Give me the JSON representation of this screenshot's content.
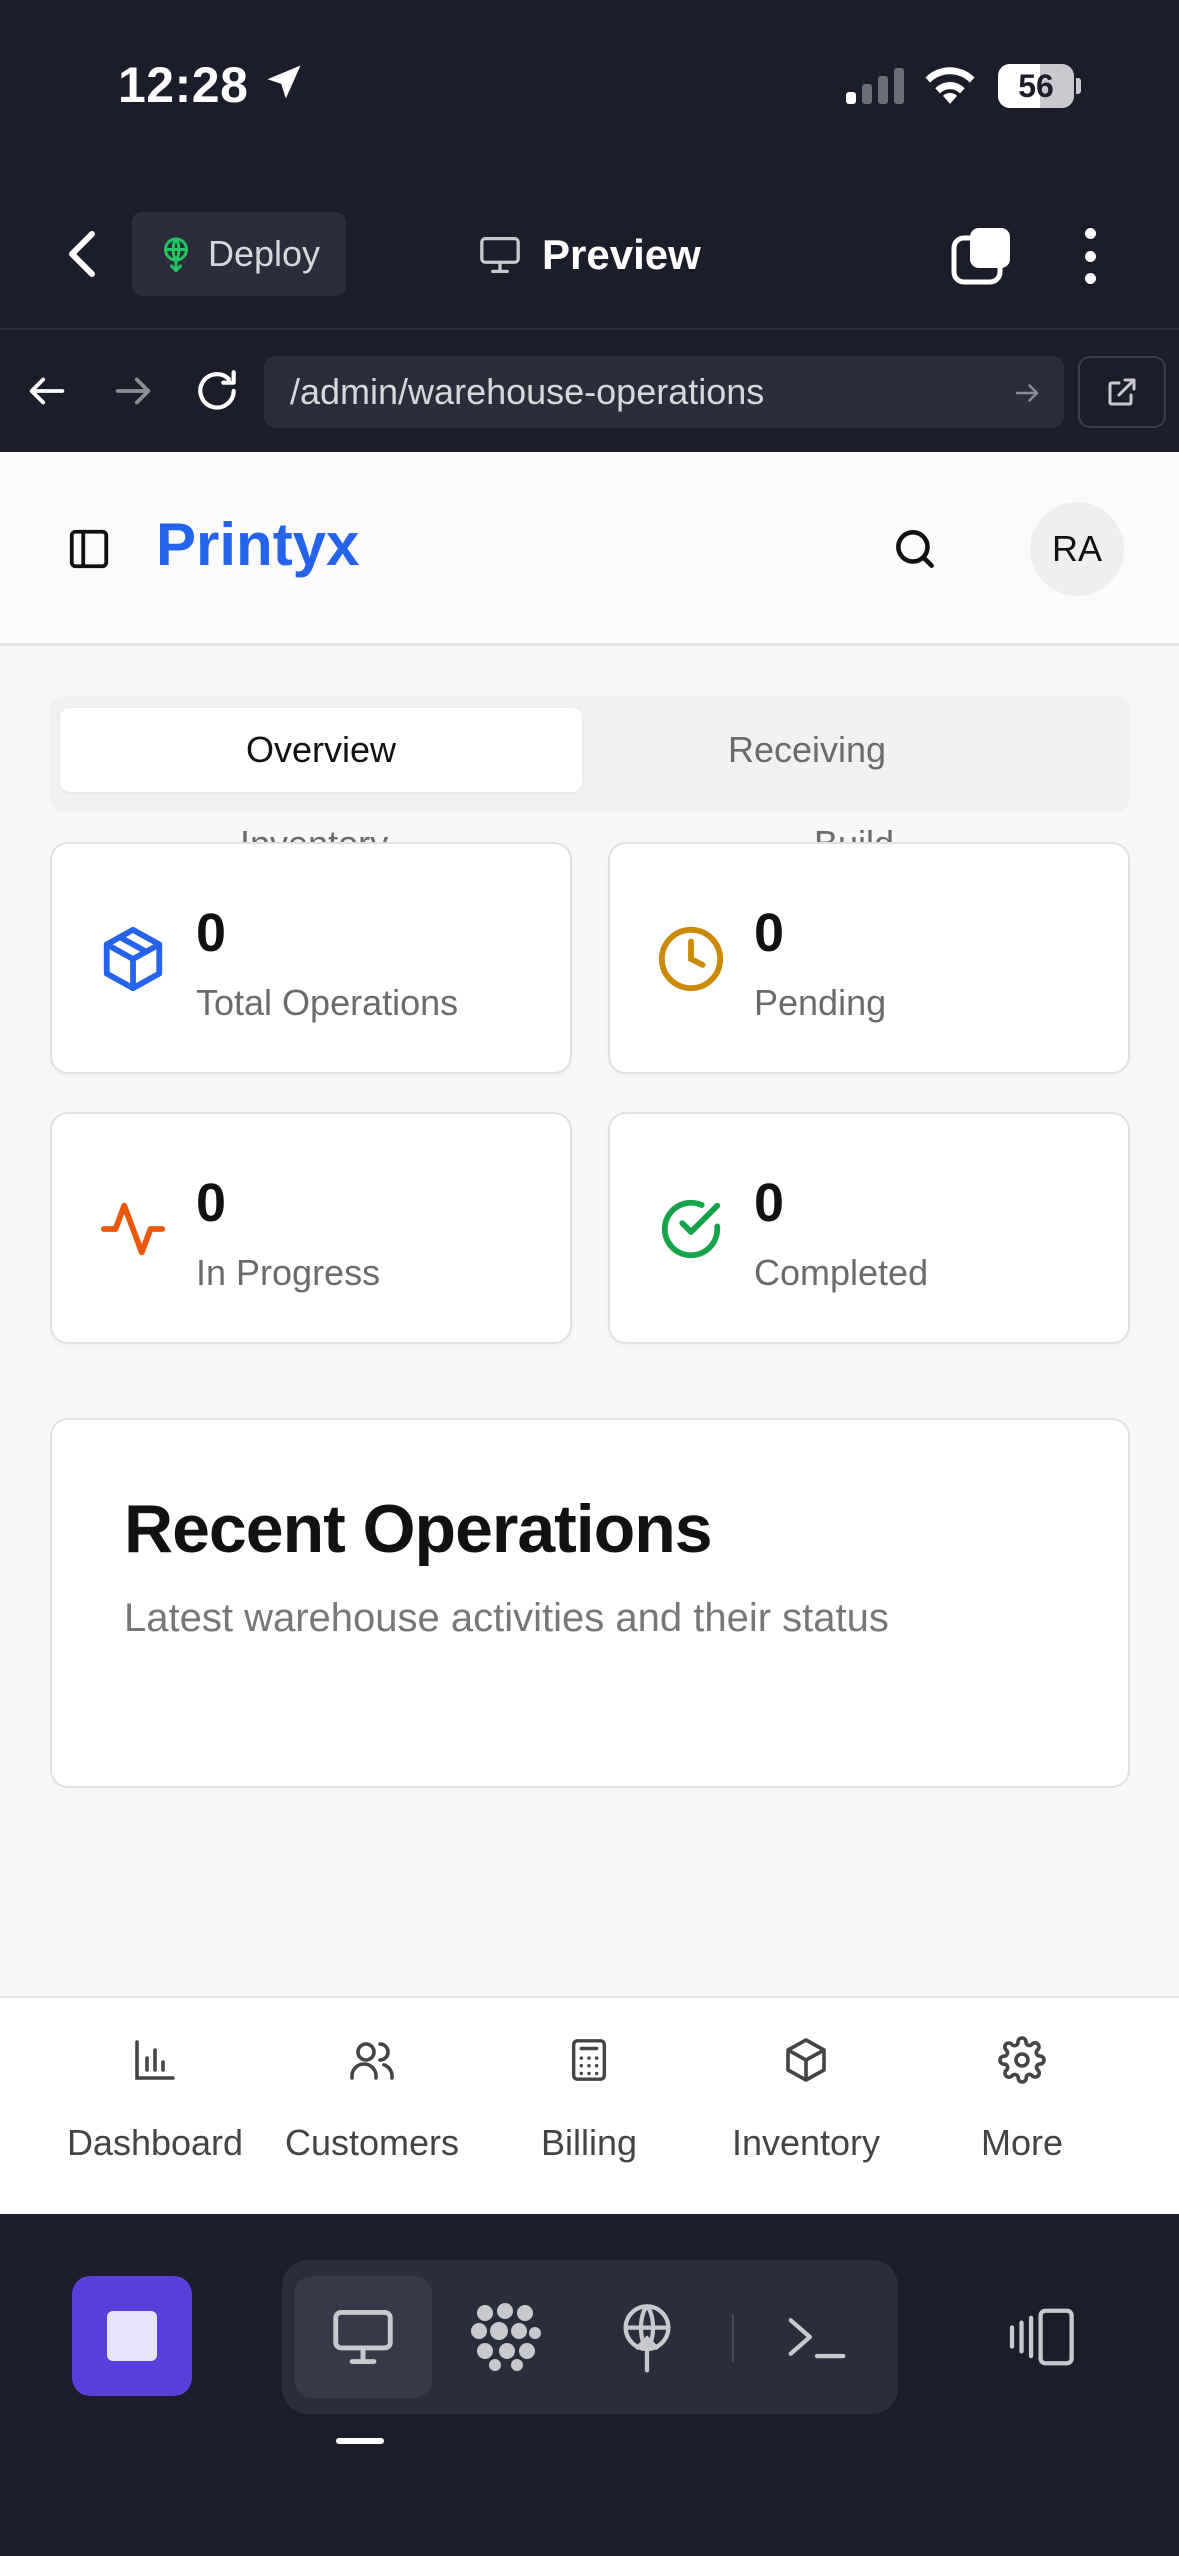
{
  "status_bar": {
    "time": "12:28",
    "battery": "56"
  },
  "app_bar": {
    "deploy_label": "Deploy",
    "preview_label": "Preview"
  },
  "browser": {
    "url": "/admin/warehouse-operations"
  },
  "header": {
    "brand": "Printyx",
    "avatar_initials": "RA"
  },
  "tabs": [
    {
      "label": "Overview",
      "active": true
    },
    {
      "label": "Receiving",
      "active": false
    },
    {
      "label": "Inventory",
      "active": false
    },
    {
      "label": "Build",
      "active": false
    }
  ],
  "stats": [
    {
      "value": "0",
      "label": "Total Operations",
      "icon": "package-icon",
      "color": "#2563eb"
    },
    {
      "value": "0",
      "label": "Pending",
      "icon": "clock-icon",
      "color": "#ca8a04"
    },
    {
      "value": "0",
      "label": "In Progress",
      "icon": "activity-icon",
      "color": "#ea580c"
    },
    {
      "value": "0",
      "label": "Completed",
      "icon": "check-circle-icon",
      "color": "#16a34a"
    }
  ],
  "recent": {
    "title": "Recent Operations",
    "subtitle": "Latest warehouse activities and their status"
  },
  "bottom_nav": [
    {
      "label": "Dashboard",
      "icon": "bar-chart-icon"
    },
    {
      "label": "Customers",
      "icon": "users-icon"
    },
    {
      "label": "Billing",
      "icon": "calculator-icon"
    },
    {
      "label": "Inventory",
      "icon": "box-icon"
    },
    {
      "label": "More",
      "icon": "gear-icon"
    }
  ],
  "colors": {
    "brand": "#2563eb",
    "dark_bg": "#1b1d2b",
    "stop_button": "#5b3fdb"
  }
}
